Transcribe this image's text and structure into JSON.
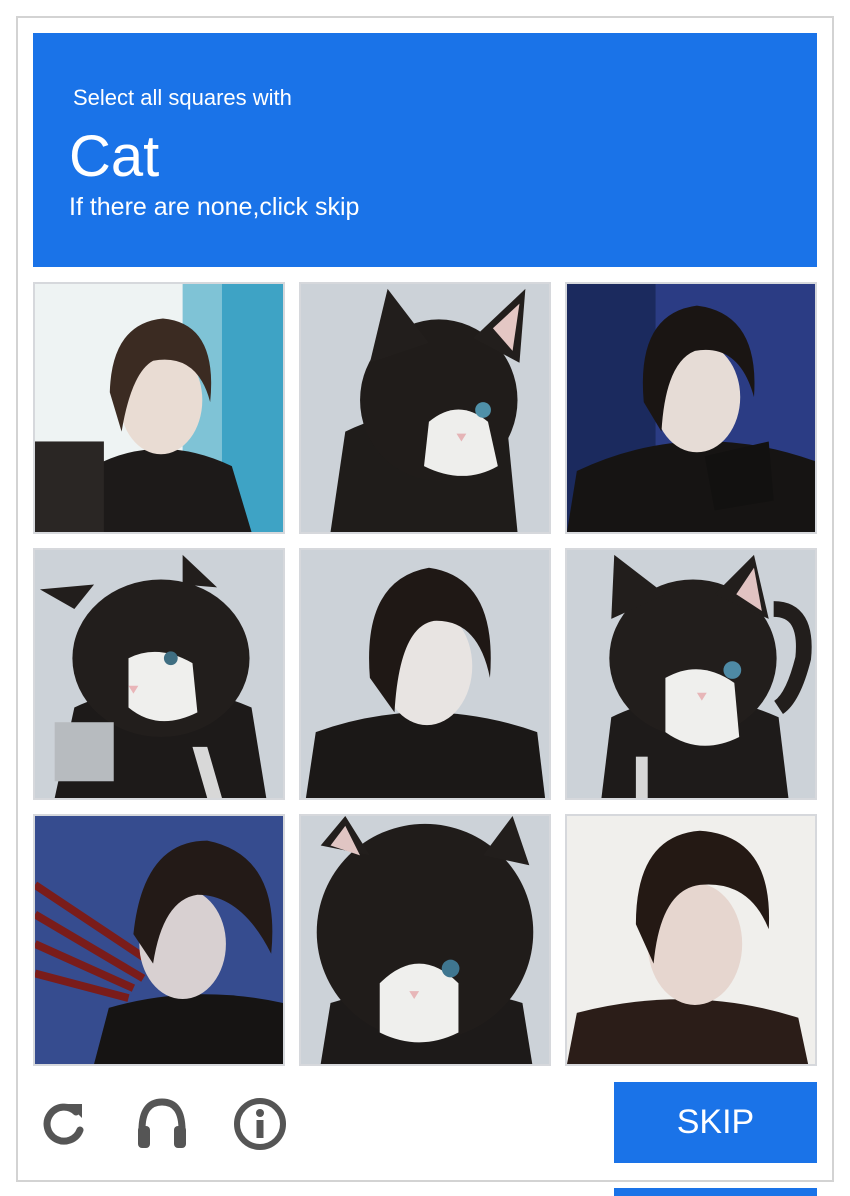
{
  "header": {
    "instruction": "Select all squares with",
    "target": "Cat",
    "hint": "If there are none,click skip",
    "color": "#1a73e8"
  },
  "tiles": [
    {
      "subject": "man-portrait",
      "background": "teal-white"
    },
    {
      "subject": "cat",
      "background": "gray"
    },
    {
      "subject": "man-portrait",
      "background": "blue"
    },
    {
      "subject": "cat",
      "background": "gray"
    },
    {
      "subject": "man-portrait",
      "background": "gray"
    },
    {
      "subject": "cat",
      "background": "gray"
    },
    {
      "subject": "man-portrait",
      "background": "blue"
    },
    {
      "subject": "cat",
      "background": "gray"
    },
    {
      "subject": "man-portrait",
      "background": "off-white"
    }
  ],
  "footer": {
    "icons": [
      "reload-icon",
      "audio-icon",
      "info-icon"
    ],
    "skip_label": "SKIP"
  }
}
